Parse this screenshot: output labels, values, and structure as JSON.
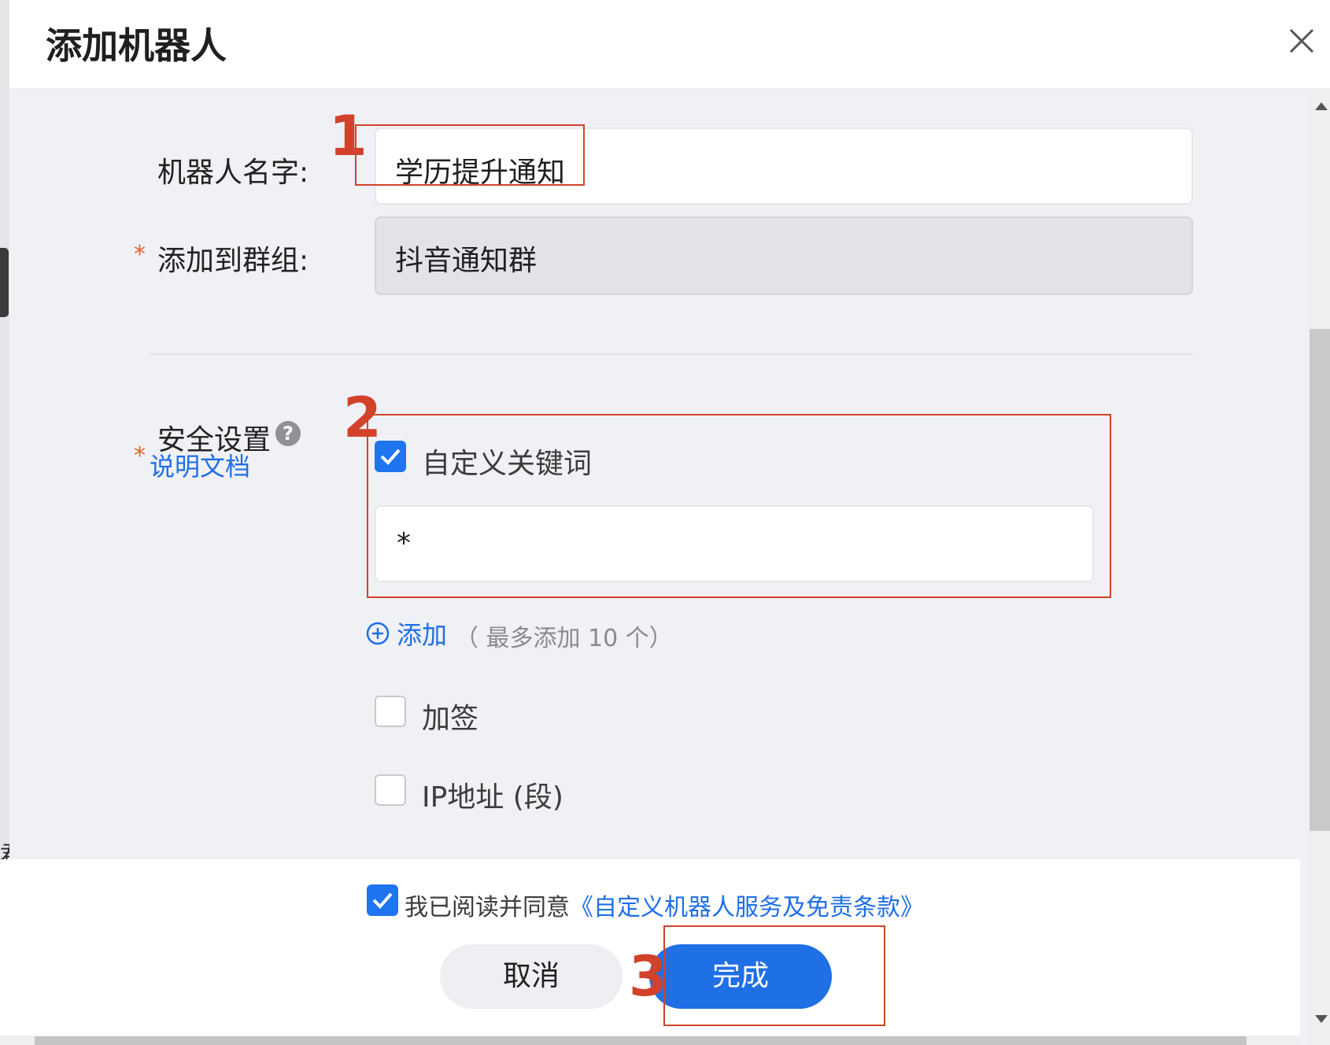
{
  "dialog": {
    "title": "添加机器人"
  },
  "form": {
    "robot_name_label": "机器人名字:",
    "robot_name_value": "学历提升通知",
    "group_label": "添加到群组:",
    "group_value": "抖音通知群",
    "required_mark": "*",
    "security_label": "安全设置",
    "help_icon_text": "?",
    "doc_link": "说明文档",
    "custom_keyword_label": "自定义关键词",
    "keyword_value": "*",
    "add_label": "添加",
    "add_hint": "（ 最多添加 10 个）",
    "signature_label": "加签",
    "ip_label": "IP地址 (段)"
  },
  "checkboxes": {
    "custom_keyword_checked": true,
    "signature_checked": false,
    "ip_checked": false,
    "agree_checked": true
  },
  "footer": {
    "agree_prefix": "我已阅读并同意",
    "agree_link": "《自定义机器人服务及免责条款》",
    "cancel_label": "取消",
    "done_label": "完成"
  },
  "annotations": {
    "one": "1",
    "two": "2",
    "three": "3"
  },
  "background": {
    "left_edge_char": "君"
  },
  "colors": {
    "accent": "#1f6fe5",
    "annotation": "#d2422b",
    "required": "#e8622d"
  }
}
